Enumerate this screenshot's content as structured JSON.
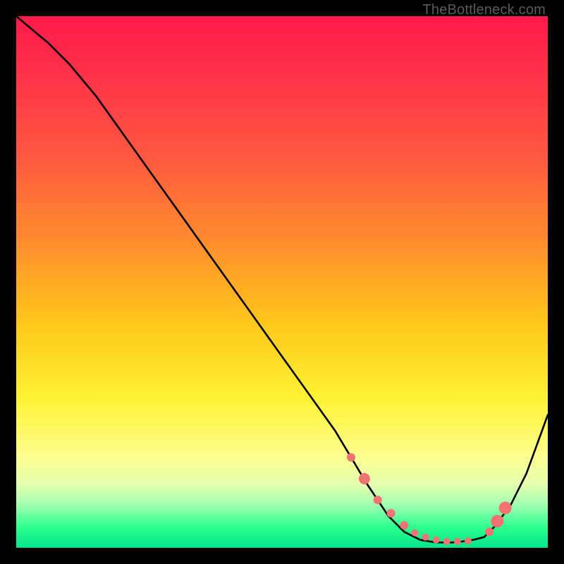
{
  "attribution": "TheBottleneck.com",
  "chart_data": {
    "type": "line",
    "title": "",
    "xlabel": "",
    "ylabel": "",
    "xlim": [
      0,
      100
    ],
    "ylim": [
      0,
      100
    ],
    "series": [
      {
        "name": "bottleneck-curve",
        "x": [
          0,
          6,
          10,
          15,
          20,
          25,
          30,
          35,
          40,
          45,
          50,
          55,
          60,
          63,
          66,
          68,
          70,
          73,
          76,
          79,
          82,
          84,
          86,
          88,
          90,
          93,
          96,
          100
        ],
        "values": [
          100,
          95,
          91,
          85,
          78,
          71,
          64,
          57,
          50,
          43,
          36,
          29,
          22,
          17,
          12,
          9,
          6,
          3,
          1.5,
          1,
          1,
          1.2,
          1.5,
          2,
          4,
          8,
          14,
          25
        ]
      }
    ],
    "markers": {
      "name": "highlighted-points",
      "color": "#f47272",
      "x": [
        63,
        65.5,
        68,
        70.5,
        73,
        75,
        77,
        79,
        81,
        83,
        85,
        89,
        90.5,
        92
      ],
      "values": [
        17,
        13,
        9,
        6.5,
        4.2,
        2.8,
        2,
        1.5,
        1.2,
        1.2,
        1.3,
        3,
        5,
        7.5
      ],
      "radius": [
        6,
        8,
        6,
        6,
        6,
        5,
        5,
        5,
        5,
        5,
        5,
        6,
        9,
        9
      ]
    }
  }
}
